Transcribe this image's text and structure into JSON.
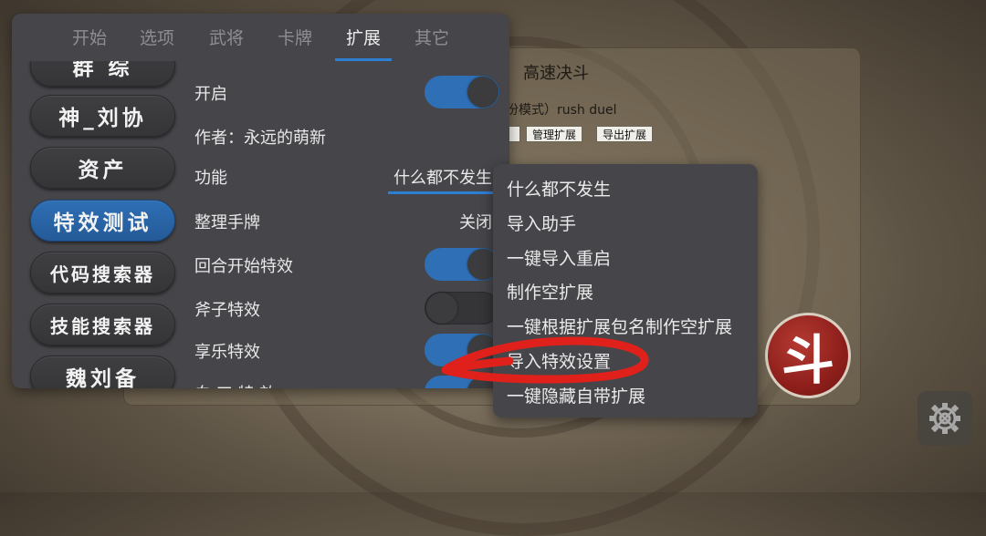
{
  "background": {
    "game_title": "高速决斗",
    "game_mode": "身份模式）rush duel",
    "buttons": [
      "管理扩展",
      "导出扩展"
    ],
    "fight_button": "斗",
    "settings_icon": "gear-icon"
  },
  "menu": {
    "tabs": [
      {
        "label": "开始"
      },
      {
        "label": "选项"
      },
      {
        "label": "武将"
      },
      {
        "label": "卡牌"
      },
      {
        "label": "扩展",
        "active": true
      },
      {
        "label": "其它"
      }
    ],
    "sidebar": [
      {
        "label": "群 综"
      },
      {
        "label": "神_刘协"
      },
      {
        "label": "资产"
      },
      {
        "label": "特效测试",
        "active": true
      },
      {
        "label": "代码搜索器"
      },
      {
        "label": "技能搜索器"
      },
      {
        "label": "魏刘备"
      }
    ],
    "content": {
      "enable_label": "开启",
      "enable_state": "on",
      "author": "作者：永远的萌新",
      "function_label": "功能",
      "function_value": "什么都不发生",
      "sort_label": "整理手牌",
      "sort_value": "关闭",
      "round_start_label": "回合开始特效",
      "round_start_state": "on",
      "axe_label": "斧子特效",
      "axe_state": "off",
      "xiangle_label": "享乐特效",
      "xiangle_state": "on",
      "partial_label": "白 工 特 效",
      "partial_state": "on"
    }
  },
  "dropdown": {
    "options": [
      "什么都不发生",
      "导入助手",
      "一键导入重启",
      "制作空扩展",
      "一键根据扩展包名制作空扩展",
      "导入特效设置",
      "一键隐藏自带扩展"
    ],
    "highlighted_index": 5
  },
  "colors": {
    "accent": "#2e6fb5",
    "panel": "#46464a",
    "annotation": "#e0201a",
    "fight_button": "#8e1f1b"
  }
}
